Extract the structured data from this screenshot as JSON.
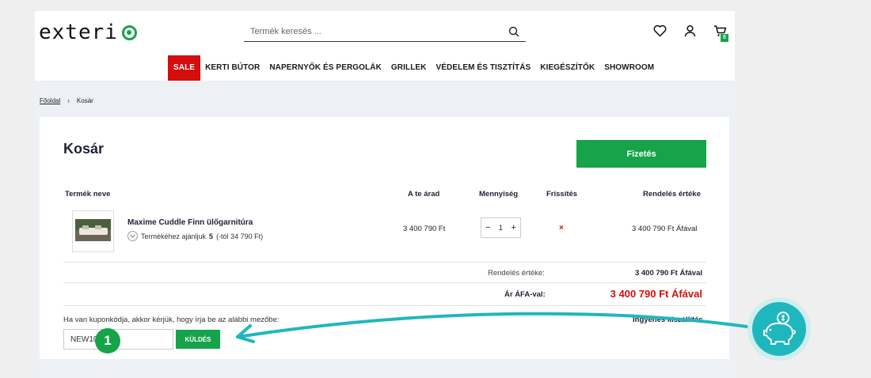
{
  "header": {
    "logo_text": "exteri",
    "search_placeholder": "Termék keresés ...",
    "cart_count": "0",
    "icons": [
      "search-icon",
      "heart-icon",
      "user-icon",
      "cart-icon"
    ]
  },
  "nav": {
    "items": [
      "SALE",
      "KERTI BÚTOR",
      "NAPERNYŐK ÉS PERGOLÁK",
      "GRILLEK",
      "VÉDELEM ÉS TISZTÍTÁS",
      "KIEGÉSZÍTŐK",
      "SHOWROOM"
    ],
    "sale_color": "#d50d0d"
  },
  "breadcrumb": {
    "home": "Főoldal",
    "separator": "›",
    "current": "Kosár"
  },
  "cart": {
    "title": "Kosár",
    "checkout_label": "Fizetés",
    "columns": {
      "name": "Termék neve",
      "price": "A te árad",
      "quantity": "Mennyiség",
      "update": "Frissítés",
      "total": "Rendelés értéke"
    },
    "item": {
      "name": "Maxime Cuddle Finn ülőgarnitúra",
      "rec_text": "Termékéhez ajánljuk",
      "rec_count": "5",
      "rec_price": "(-tól 34 790 Ft)",
      "price": "3 400 790 Ft",
      "qty": "1",
      "minus": "−",
      "plus": "+",
      "remove": "×",
      "total": "3 400 790 Ft Áfával"
    },
    "summary": {
      "order_label": "Rendelés értéke:",
      "order_value": "3 400 790 Ft Áfával",
      "vat_label": "Ár ÁFA-val:",
      "vat_value": "3 400 790 Ft Áfával"
    },
    "coupon": {
      "label": "Ha van kuponkódja, akkor kérjük, hogy írja be az alábbi mezőbe:",
      "value": "NEW10",
      "button": "KÜLDÉS"
    },
    "shipping": "Ingyenes kiszállítás"
  },
  "annotation": {
    "step": "1",
    "accent": "#1fb7be",
    "icon": "piggy-bank-icon"
  },
  "colors": {
    "green": "#16a34a",
    "red": "#d50d0d"
  }
}
